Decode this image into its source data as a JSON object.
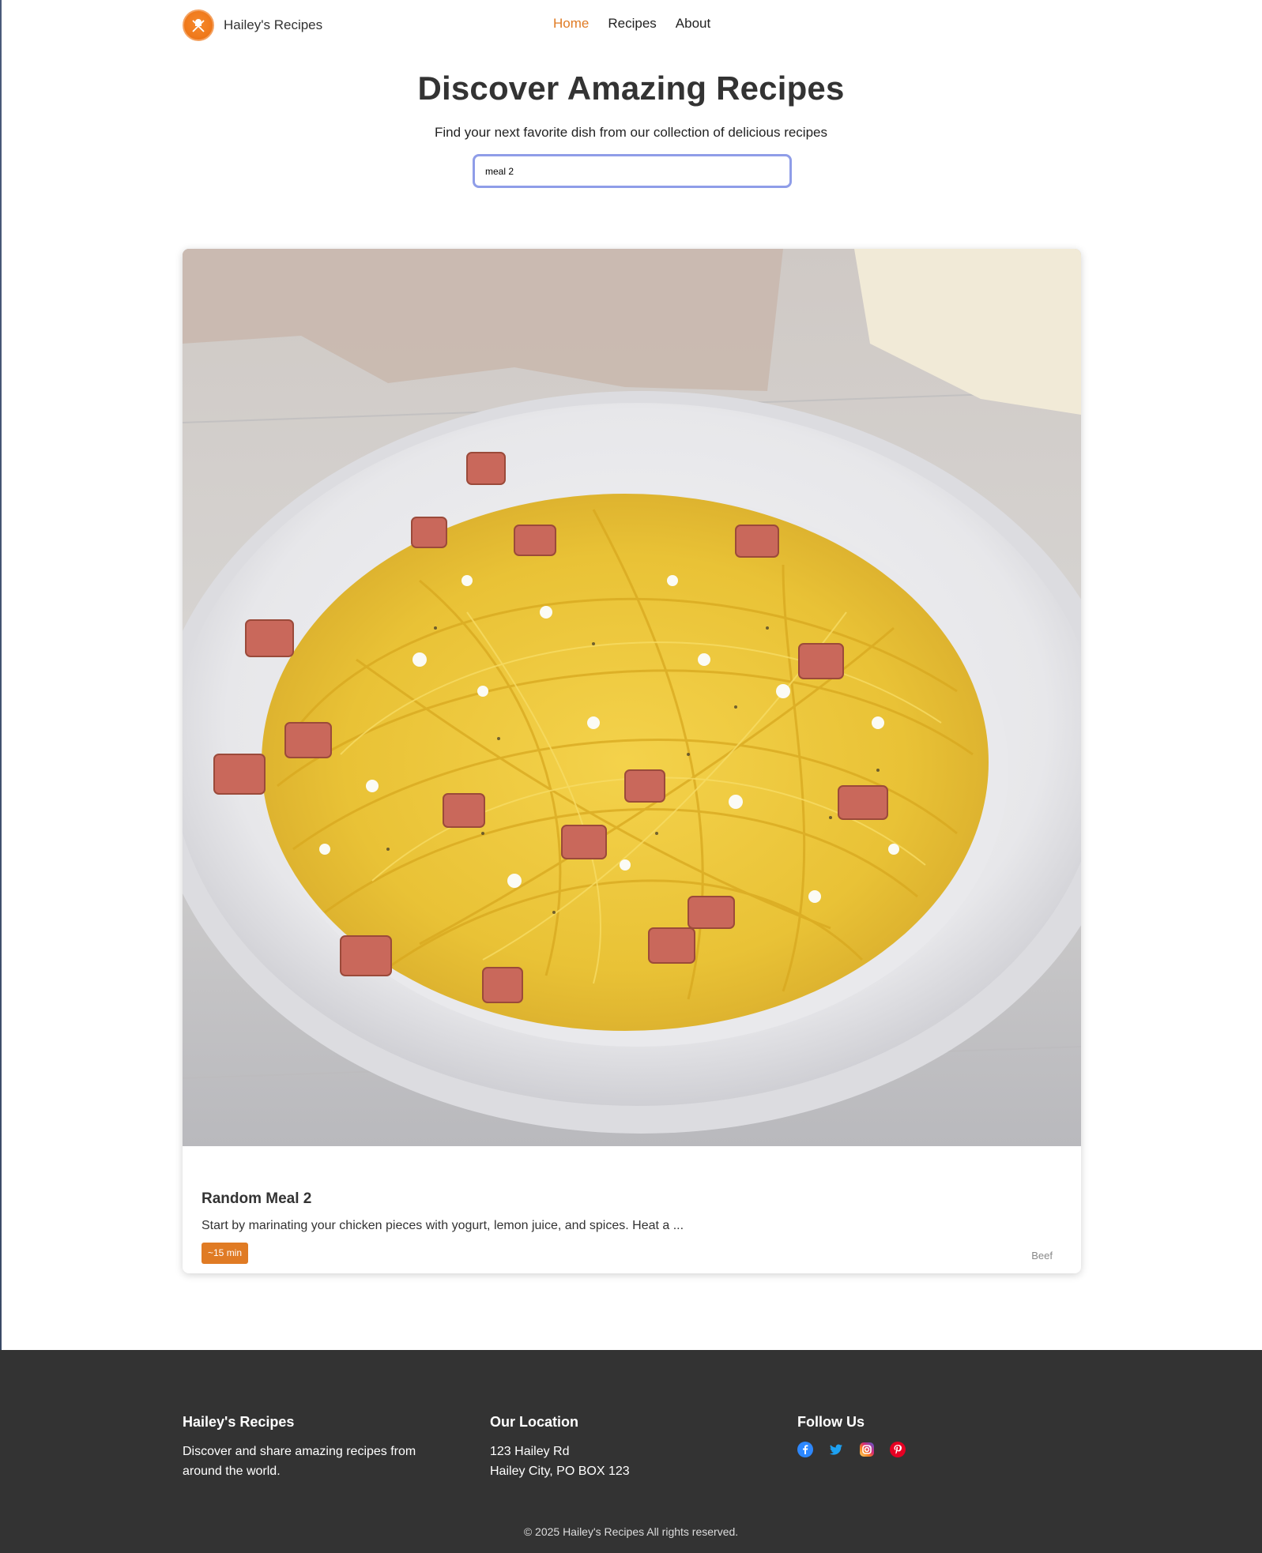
{
  "nav": {
    "brand": "Hailey's Recipes",
    "links": [
      {
        "label": "Home",
        "active": true
      },
      {
        "label": "Recipes",
        "active": false
      },
      {
        "label": "About",
        "active": false
      }
    ]
  },
  "hero": {
    "title": "Discover Amazing Recipes",
    "subtitle": "Find your next favorite dish from our collection of delicious recipes",
    "search_value": "meal 2"
  },
  "recipe": {
    "title": "Random Meal 2",
    "description": "Start by marinating your chicken pieces with yogurt, lemon juice, and spices. Heat a ...",
    "time": "~15 min",
    "category": "Beef",
    "image_icon": "spaghetti-carbonara-photo"
  },
  "footer": {
    "about": {
      "title": "Hailey's Recipes",
      "text_line1": "Discover and share amazing recipes from",
      "text_line2": "around the world."
    },
    "location": {
      "title": "Our Location",
      "line1": "123 Hailey Rd",
      "line2": "Hailey City, PO BOX 123"
    },
    "social": {
      "title": "Follow Us",
      "icons": [
        "facebook-icon",
        "twitter-icon",
        "instagram-icon",
        "pinterest-icon"
      ]
    },
    "copyright": "© 2025 Hailey's Recipes All rights reserved."
  },
  "colors": {
    "accent": "#e07b24",
    "footer_bg": "#333333",
    "search_border": "#8f9de8"
  }
}
